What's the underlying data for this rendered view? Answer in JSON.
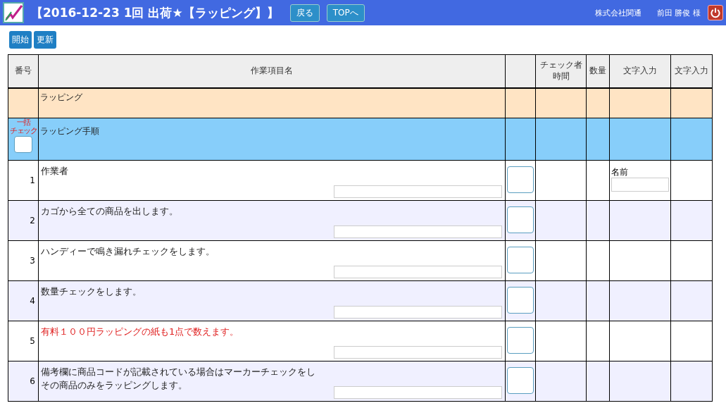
{
  "header": {
    "title": "【2016-12-23 1回 出荷★【ラッピング】】",
    "buttons": [
      "戻る",
      "TOPへ"
    ],
    "company": "株式会社関通",
    "user": "前田 勝俊 様"
  },
  "toolbar": {
    "buttons": [
      "開始",
      "更新"
    ]
  },
  "table": {
    "columns": [
      [
        "番号"
      ],
      [
        "作業項目名"
      ],
      [],
      [
        "チェック者",
        "時間"
      ],
      [
        "数量"
      ],
      [
        "文字入力"
      ],
      [
        "文字入力"
      ]
    ],
    "category": "ラッピング",
    "group": {
      "name": "ラッピング手順",
      "bulk_label": [
        "一括",
        "チェック"
      ],
      "checked": false
    },
    "rows": [
      {
        "number": "1",
        "lines": [
          "作業者"
        ],
        "highlight": false,
        "checked": false,
        "text_input": {
          "label": "名前"
        }
      },
      {
        "number": "2",
        "lines": [
          "カゴから全ての商品を出します。"
        ],
        "highlight": false,
        "checked": false
      },
      {
        "number": "3",
        "lines": [
          "ハンディーで鳴き漏れチェックをします。"
        ],
        "highlight": false,
        "checked": false
      },
      {
        "number": "4",
        "lines": [
          "数量チェックをします。"
        ],
        "highlight": false,
        "checked": false
      },
      {
        "number": "5",
        "lines": [
          "有料１００円ラッピングの紙も1点で数えます。"
        ],
        "highlight": true,
        "checked": false
      },
      {
        "number": "6",
        "lines": [
          "備考欄に商品コードが記載されている場合はマーカーチェックをし",
          "その商品のみをラッピングします。"
        ],
        "highlight": false,
        "checked": false
      }
    ]
  }
}
